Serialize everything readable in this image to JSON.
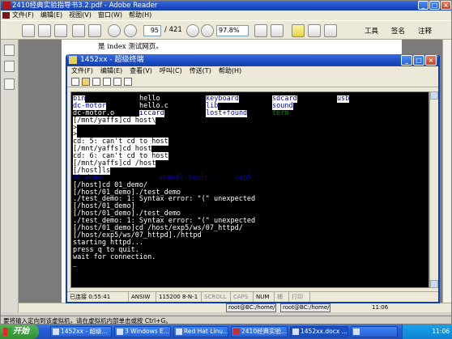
{
  "reader": {
    "title": "2410经典实验指导书3.2.pdf - Adobe Reader",
    "menu": [
      "文件(F)",
      "编辑(E)",
      "视图(V)",
      "窗口(W)",
      "帮助(H)"
    ],
    "page_current": "95",
    "page_total": "/ 421",
    "zoom": "97.8%",
    "tools_label": "工具",
    "sign_label": "签名",
    "comment_label": "注释",
    "page_text": "是 index 测试网页。"
  },
  "terminal": {
    "title": "1452xx - 超级终端",
    "menu": [
      "文件(F)",
      "编辑(E)",
      "查看(V)",
      "呼叫(C)",
      "传送(T)",
      "帮助(H)"
    ],
    "ls_rows": [
      [
        {
          "t": "bin",
          "c": "blue"
        },
        {
          "t": "hello",
          "c": "white"
        },
        {
          "t": "keyboard",
          "c": "blue"
        },
        {
          "t": "sdcard",
          "c": "blue"
        },
        {
          "t": "usb",
          "c": "blue"
        }
      ],
      [
        {
          "t": "dc-motor",
          "c": "blue"
        },
        {
          "t": "hello.c",
          "c": "white"
        },
        {
          "t": "lib",
          "c": "blue"
        },
        {
          "t": "sound",
          "c": "blue"
        }
      ],
      [
        {
          "t": "dc-motor.o",
          "c": "white"
        },
        {
          "t": "iccard",
          "c": "blue"
        },
        {
          "t": "lost+found",
          "c": "blue"
        },
        {
          "t": "term",
          "c": "green"
        }
      ]
    ],
    "lines_top": [
      "[/mnt/yaffs]cd host\\",
      ">",
      ">",
      "cd: 5: can't cd to host",
      "[/mnt/yaffs]cd host",
      "cd: 6: can't cd to host",
      "[/mnt/yaffs]cd /host",
      "[/host]ls"
    ],
    "ls2_row": [
      {
        "t": "01_demo",
        "c": "blue"
      },
      {
        "t": "armv4l-tools",
        "c": "blue"
      },
      {
        "t": "exp5",
        "c": "blue"
      }
    ],
    "lines_bottom": [
      "[/host]cd 01_demo/",
      "[/host/01_demo]./test_demo",
      "./test_demo: 1: Syntax error: \"(\" unexpected",
      "[/host/01_demo]",
      "[/host/01_demo]./test_demo",
      "./test_demo: 1: Syntax error: \"(\" unexpected",
      "[/host/01_demo]cd /host/exp5/ws/07_httpd/",
      "[/host/exp5/ws/07_httpd]./httpd",
      "starting httpd...",
      "press q to quit.",
      "wait for connection.",
      "_"
    ],
    "status": {
      "conn": "已连接 0:55:41",
      "emu": "ANSIW",
      "port": "115200 8-N-1",
      "scroll": "SCROLL",
      "caps": "CAPS",
      "num": "NUM",
      "capture": "捕",
      "print": "打印"
    }
  },
  "under_tasks": [
    "root@BC:/home/t",
    "root@BC:/home/t"
  ],
  "under_clock": "11:06",
  "vm_status": "要将输入定向到该虚拟机，请在虚拟机内部单击或按 Ctrl+G。",
  "taskbar": {
    "start": "开始",
    "tasks": [
      "1452xx - 超级...",
      "3 Windows E...",
      "Red Hat Linu...",
      "2410经典实验...",
      "1452xx.docx ...",
      ""
    ],
    "clock": "11:06"
  },
  "colors": {
    "xp_blue": "#245dd6",
    "terminal_bg": "#000000",
    "ls_dir": "#0000d0",
    "ls_exec": "#009000"
  }
}
